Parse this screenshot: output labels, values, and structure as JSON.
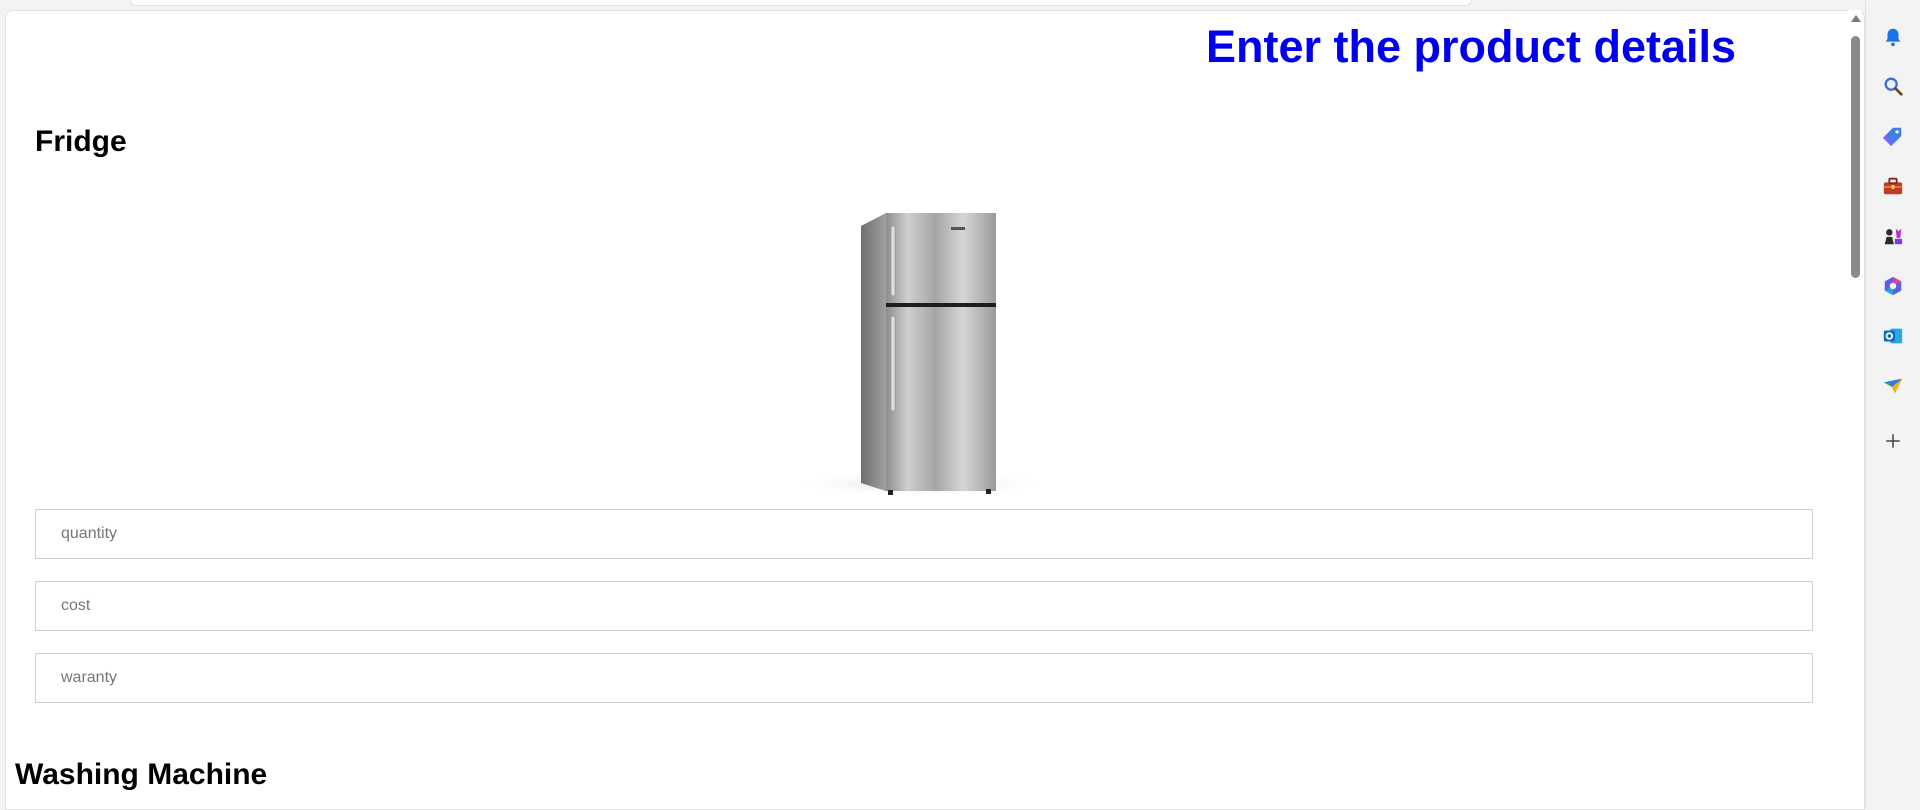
{
  "header": {
    "title": "Enter the product details"
  },
  "products": [
    {
      "name": "Fridge",
      "fields": [
        {
          "placeholder": "quantity",
          "value": ""
        },
        {
          "placeholder": "cost",
          "value": ""
        },
        {
          "placeholder": "waranty",
          "value": ""
        }
      ]
    },
    {
      "name": "Washing Machine"
    }
  ],
  "sidebar": {
    "icons": [
      "bell-icon",
      "search-icon",
      "tag-icon",
      "toolbox-icon",
      "chess-icon",
      "copilot-icon",
      "outlook-icon",
      "send-icon",
      "add-icon"
    ]
  },
  "colors": {
    "heading": "#0000ee",
    "field_border": "#cfcfcf"
  }
}
